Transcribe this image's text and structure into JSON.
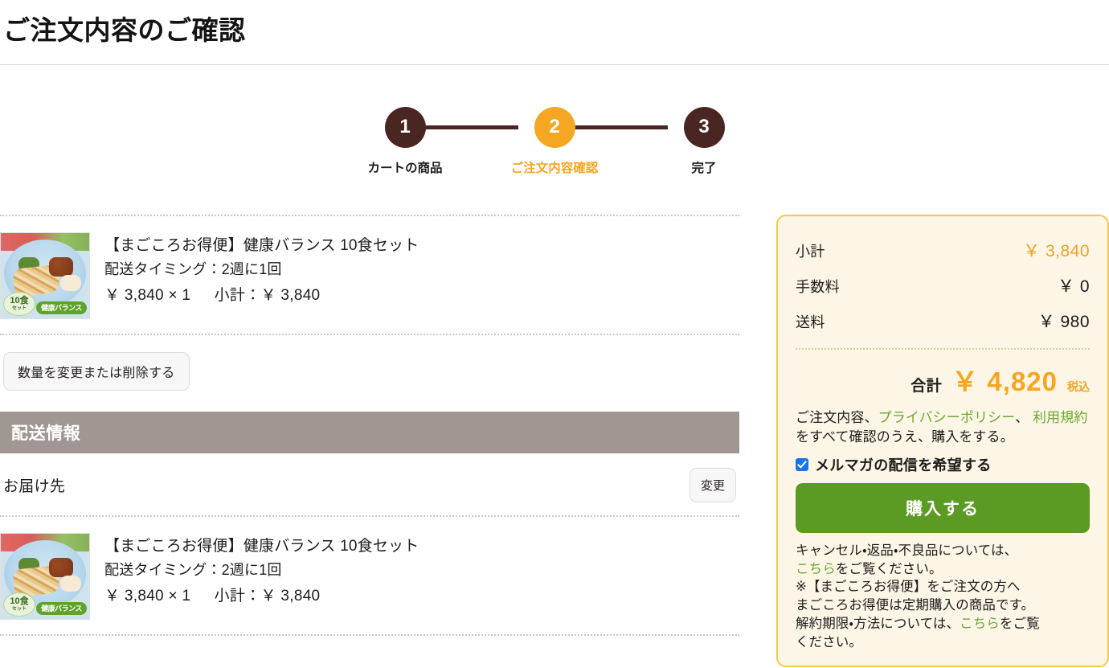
{
  "page": {
    "title": "ご注文内容のご確認"
  },
  "steps": [
    {
      "number": "1",
      "label": "カートの商品",
      "state": "done"
    },
    {
      "number": "2",
      "label": "ご注文内容確認",
      "state": "active"
    },
    {
      "number": "3",
      "label": "完了",
      "state": "done"
    }
  ],
  "cart": {
    "items": [
      {
        "name": "【まごころお得便】健康バランス 10食セット",
        "timing": "配送タイミング：2週に1回",
        "unit_price": "￥ 3,840",
        "multiply": "×",
        "quantity": "1",
        "subtotal_label": "小計：",
        "subtotal": "￥ 3,840",
        "thumb_badge_count": "10食",
        "thumb_badge_unit": "セット",
        "thumb_badge_name": "健康バランス"
      }
    ],
    "edit_button": "数量を変更または削除する"
  },
  "shipping": {
    "section_title": "配送情報",
    "address_label": "お届け先",
    "change_button": "変更",
    "items": [
      {
        "name": "【まごころお得便】健康バランス 10食セット",
        "timing": "配送タイミング：2週に1回",
        "unit_price": "￥ 3,840",
        "multiply": "×",
        "quantity": "1",
        "subtotal_label": "小計：",
        "subtotal": "￥ 3,840",
        "thumb_badge_count": "10食",
        "thumb_badge_unit": "セット",
        "thumb_badge_name": "健康バランス"
      }
    ]
  },
  "summary": {
    "rows": [
      {
        "label": "小計",
        "value": "￥ 3,840",
        "accent": true
      },
      {
        "label": "手数料",
        "value": "￥ 0",
        "accent": false
      },
      {
        "label": "送料",
        "value": "￥ 980",
        "accent": false
      }
    ],
    "total_label": "合計",
    "total_value": "￥ 4,820",
    "total_tax": "税込",
    "agree": {
      "prefix": "ご注文内容、",
      "link_privacy": "プライバシーポリシー",
      "middle": "、 ",
      "link_terms": "利用規約",
      "suffix": "をすべて確認のうえ、購入をする。"
    },
    "mailmag_label": "メルマガの配信を希望する",
    "mailmag_checked": true,
    "buy_button": "購入する",
    "notes": {
      "line1": "キャンセル・返品・不良品については、",
      "line1_link": "こちら",
      "line1_tail": "をご覧ください。",
      "line2": "※【まごころお得便】をご注文の方へ",
      "line3": "まごころお得便は定期購入の商品です。",
      "line4_head": "解約期限・方法については、",
      "line4_link": "こちら",
      "line4_tail": "をご覧",
      "line5": "ください。"
    }
  },
  "colors": {
    "step_done": "#4a2623",
    "step_active": "#f5a623",
    "accent_orange": "#f5a623",
    "link_green": "#6aa832",
    "buy_green": "#5b9a23",
    "panel_bg": "#fdf6e6",
    "panel_border": "#f2ca4c",
    "section_bar": "#a09793",
    "checkbox_blue": "#1a73e8"
  }
}
